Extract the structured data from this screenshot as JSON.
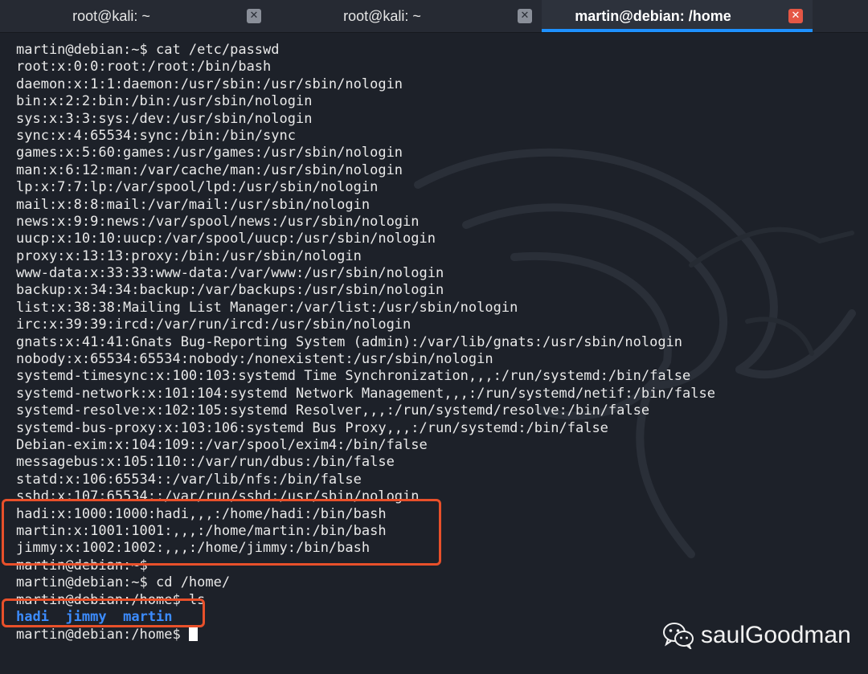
{
  "tabs": [
    {
      "label": "root@kali: ~",
      "active": false
    },
    {
      "label": "root@kali: ~",
      "active": false
    },
    {
      "label": "martin@debian: /home",
      "active": true
    }
  ],
  "terminal": {
    "command_cat": "martin@debian:~$ cat /etc/passwd",
    "passwd_lines": [
      "root:x:0:0:root:/root:/bin/bash",
      "daemon:x:1:1:daemon:/usr/sbin:/usr/sbin/nologin",
      "bin:x:2:2:bin:/bin:/usr/sbin/nologin",
      "sys:x:3:3:sys:/dev:/usr/sbin/nologin",
      "sync:x:4:65534:sync:/bin:/bin/sync",
      "games:x:5:60:games:/usr/games:/usr/sbin/nologin",
      "man:x:6:12:man:/var/cache/man:/usr/sbin/nologin",
      "lp:x:7:7:lp:/var/spool/lpd:/usr/sbin/nologin",
      "mail:x:8:8:mail:/var/mail:/usr/sbin/nologin",
      "news:x:9:9:news:/var/spool/news:/usr/sbin/nologin",
      "uucp:x:10:10:uucp:/var/spool/uucp:/usr/sbin/nologin",
      "proxy:x:13:13:proxy:/bin:/usr/sbin/nologin",
      "www-data:x:33:33:www-data:/var/www:/usr/sbin/nologin",
      "backup:x:34:34:backup:/var/backups:/usr/sbin/nologin",
      "list:x:38:38:Mailing List Manager:/var/list:/usr/sbin/nologin",
      "irc:x:39:39:ircd:/var/run/ircd:/usr/sbin/nologin",
      "gnats:x:41:41:Gnats Bug-Reporting System (admin):/var/lib/gnats:/usr/sbin/nologin",
      "nobody:x:65534:65534:nobody:/nonexistent:/usr/sbin/nologin",
      "systemd-timesync:x:100:103:systemd Time Synchronization,,,:/run/systemd:/bin/false",
      "systemd-network:x:101:104:systemd Network Management,,,:/run/systemd/netif:/bin/false",
      "systemd-resolve:x:102:105:systemd Resolver,,,:/run/systemd/resolve:/bin/false",
      "systemd-bus-proxy:x:103:106:systemd Bus Proxy,,,:/run/systemd:/bin/false",
      "Debian-exim:x:104:109::/var/spool/exim4:/bin/false",
      "messagebus:x:105:110::/var/run/dbus:/bin/false",
      "statd:x:106:65534::/var/lib/nfs:/bin/false",
      "sshd:x:107:65534::/var/run/sshd:/usr/sbin/nologin",
      "hadi:x:1000:1000:hadi,,,:/home/hadi:/bin/bash",
      "martin:x:1001:1001:,,,:/home/martin:/bin/bash",
      "jimmy:x:1002:1002:,,,:/home/jimmy:/bin/bash"
    ],
    "prompt_empty": "martin@debian:~$",
    "command_cd": "martin@debian:~$ cd /home/",
    "command_ls": "martin@debian:/home$ ls",
    "ls_output": [
      "hadi",
      "jimmy",
      "martin"
    ],
    "final_prompt": "martin@debian:/home$ "
  },
  "watermark": {
    "icon": "wechat-icon",
    "label": "saulGoodman"
  },
  "colors": {
    "background": "#1d2129",
    "active_tab_underline": "#1e90ff",
    "close_active": "#e55745",
    "highlight_box": "#e8502a",
    "ls_dir": "#3c8cff"
  }
}
